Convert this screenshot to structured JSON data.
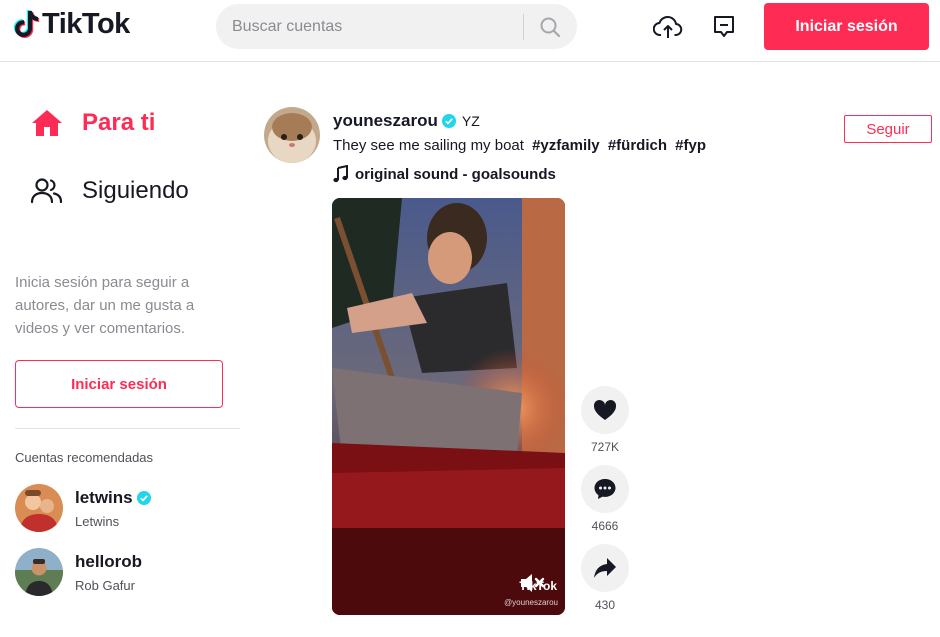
{
  "header": {
    "logo_text": "TikTok",
    "search_placeholder": "Buscar cuentas",
    "login_label": "Iniciar sesión",
    "upload_icon": "cloud-upload-icon",
    "messages_icon": "message-box-icon"
  },
  "sidebar": {
    "nav": [
      {
        "label": "Para ti",
        "icon": "home-icon",
        "active": true
      },
      {
        "label": "Siguiendo",
        "icon": "users-icon",
        "active": false
      }
    ],
    "login_prompt": "Inicia sesión para seguir a autores, dar un me gusta a videos y ver comentarios.",
    "login_label": "Iniciar sesión",
    "recommended_title": "Cuentas recomendadas",
    "accounts": [
      {
        "handle": "letwins",
        "nickname": "Letwins",
        "verified": true
      },
      {
        "handle": "hellorob",
        "nickname": "Rob Gafur",
        "verified": false
      }
    ]
  },
  "post": {
    "username": "youneszarou",
    "verified": true,
    "nickname": "YZ",
    "follow_label": "Seguir",
    "caption": "They see me sailing my boat",
    "hashtags": [
      "#yzfamily",
      "#fürdich",
      "#fyp"
    ],
    "music": "original sound - goalsounds",
    "watermark_brand": "TikTok",
    "watermark_user": "@youneszarou",
    "actions": {
      "likes": "727K",
      "comments": "4666",
      "shares": "430"
    }
  },
  "colors": {
    "brand": "#fe2c55",
    "verified": "#20d5ec",
    "text": "#161823",
    "muted": "#8a8b91"
  }
}
